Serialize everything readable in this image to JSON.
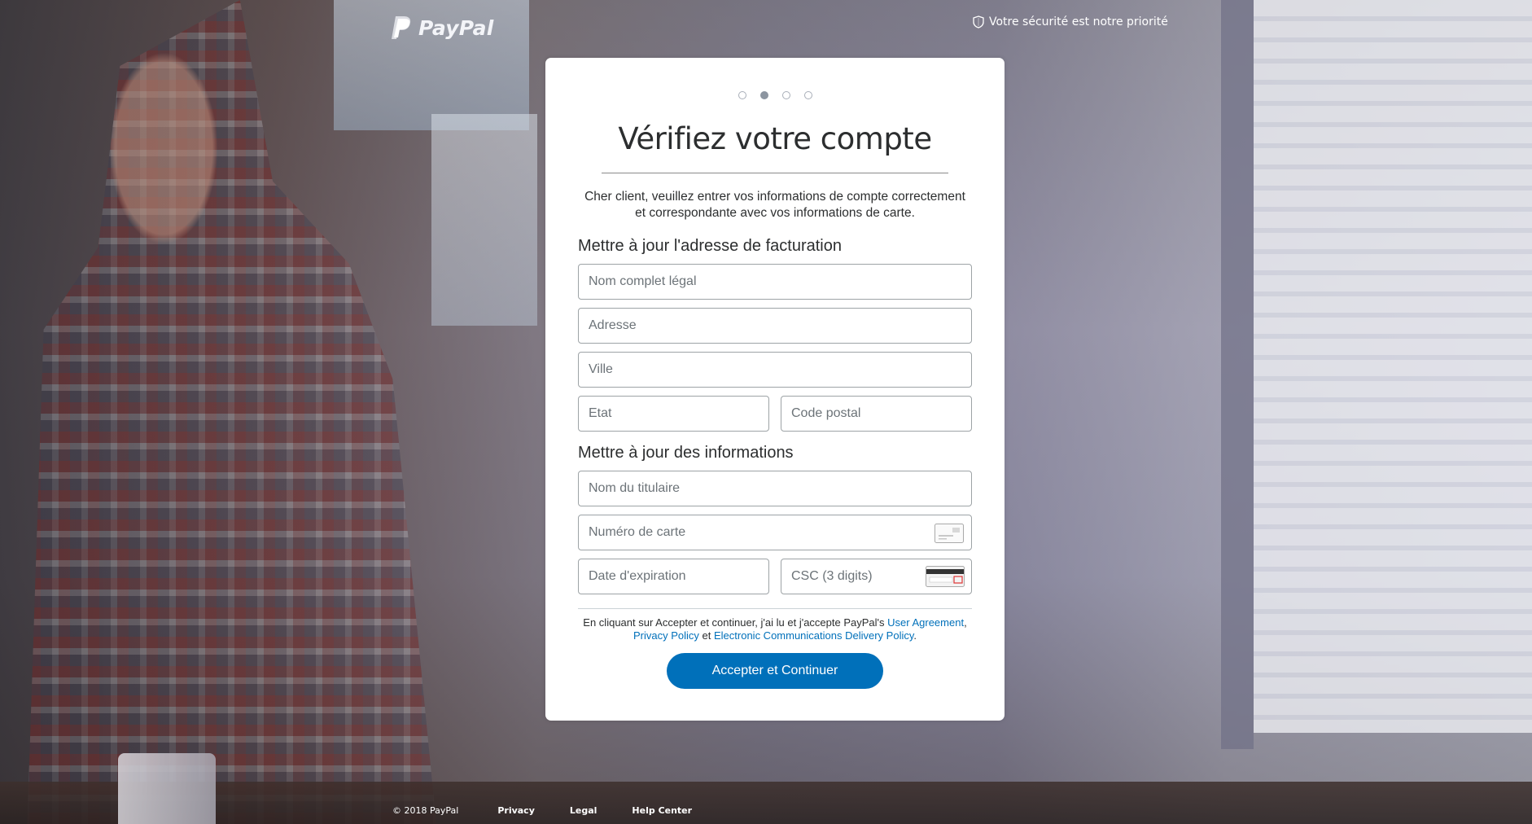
{
  "header": {
    "logo_text": "PayPal",
    "security_text": "Votre sécurité est notre priorité"
  },
  "steps": {
    "total": 4,
    "active_index": 1
  },
  "card": {
    "title": "Vérifiez votre compte",
    "intro": "Cher client, veuillez entrer vos informations de compte correctement et correspondante avec vos informations de carte.",
    "billing_heading": "Mettre à jour l'adresse de facturation",
    "billing_fields": {
      "full_name_placeholder": "Nom complet légal",
      "address_placeholder": "Adresse",
      "city_placeholder": "Ville",
      "state_placeholder": "Etat",
      "postal_placeholder": "Code postal"
    },
    "info_heading": "Mettre à jour des informations",
    "card_fields": {
      "holder_placeholder": "Nom du titulaire",
      "number_placeholder": "Numéro de carte",
      "expiry_placeholder": "Date d'expiration",
      "csc_placeholder": "CSC (3 digits)"
    },
    "legal": {
      "prefix": "En cliquant sur Accepter et continuer, j'ai lu et j'accepte PayPal's ",
      "user_agreement": "User Agreement",
      "comma": ",",
      "privacy_policy": "Privacy Policy",
      "and": " et ",
      "ecd_policy": "Electronic Communications Delivery Policy",
      "period": "."
    },
    "submit_label": "Accepter et Continuer"
  },
  "footer": {
    "copyright": "© 2018 PayPal",
    "links": [
      "Privacy",
      "Legal",
      "Help Center"
    ]
  },
  "colors": {
    "brand_blue": "#0070ba",
    "text_dark": "#2c2e2f",
    "placeholder": "#6c7378",
    "field_border": "#9da3a6"
  }
}
